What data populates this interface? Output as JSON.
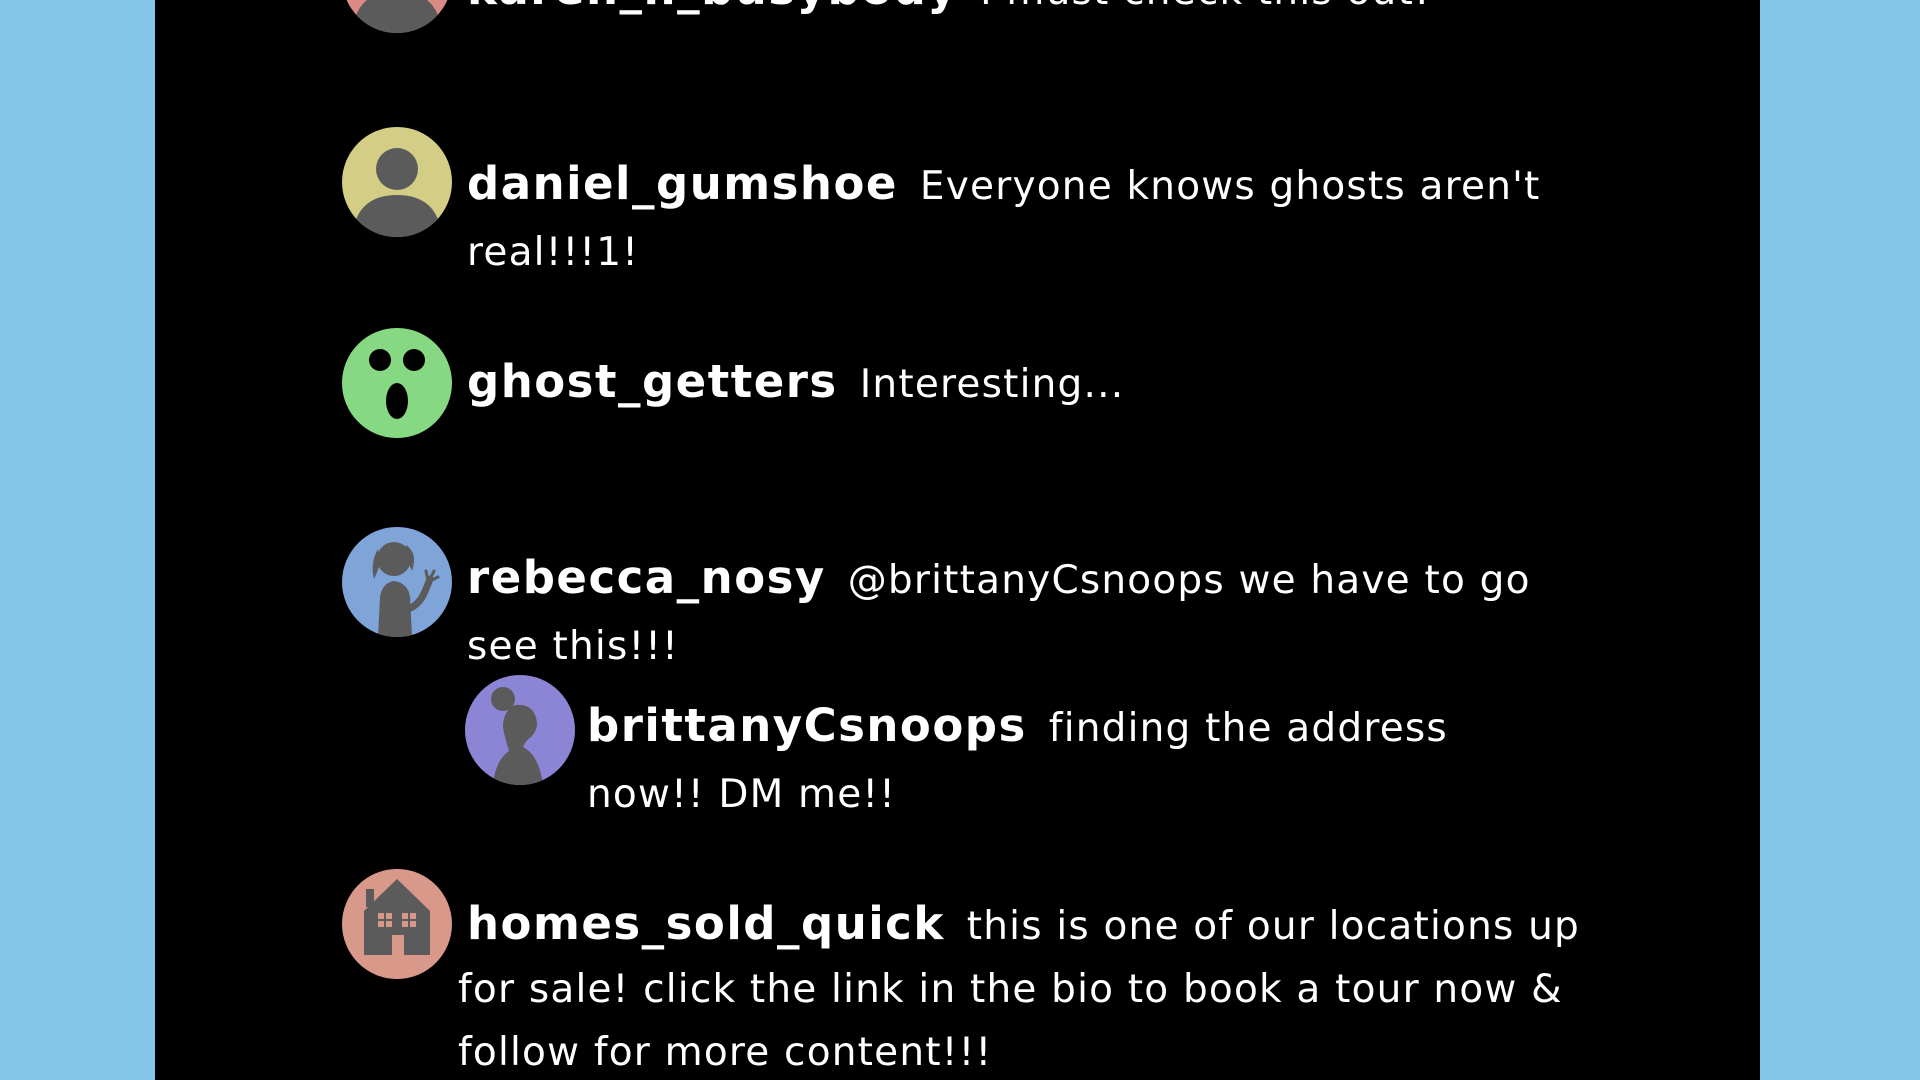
{
  "colors": {
    "page_background": "#86c6ea",
    "panel_background": "#000000",
    "text": "#ffffff",
    "avatar_yellow": "#d3cd85",
    "avatar_green": "#86d883",
    "avatar_blue": "#7ea4d8",
    "avatar_purple": "#8c84d4",
    "avatar_salmon": "#d9998a",
    "avatar_red": "#d98b84",
    "silhouette": "#5b5b5b"
  },
  "comments": [
    {
      "username": "karen_h_busybody",
      "text": "I must check this out!",
      "avatar_icon": "person-icon"
    },
    {
      "username": "daniel_gumshoe",
      "text": "Everyone knows ghosts aren't real!!!1!",
      "avatar_icon": "person-icon"
    },
    {
      "username": "ghost_getters",
      "text": "Interesting...",
      "avatar_icon": "ghost-face-icon"
    },
    {
      "username": "rebecca_nosy",
      "text": "@brittanyCsnoops we have to go see this!!!",
      "avatar_icon": "woman-waving-icon",
      "reply": {
        "username": "brittanyCsnoops",
        "text": "finding the address now!! DM me!!",
        "avatar_icon": "woman-profile-icon"
      }
    },
    {
      "username": "homes_sold_quick",
      "text": "this is one of our locations up for sale! click the link in the bio to book a tour now & follow for more content!!!",
      "avatar_icon": "house-icon"
    }
  ]
}
